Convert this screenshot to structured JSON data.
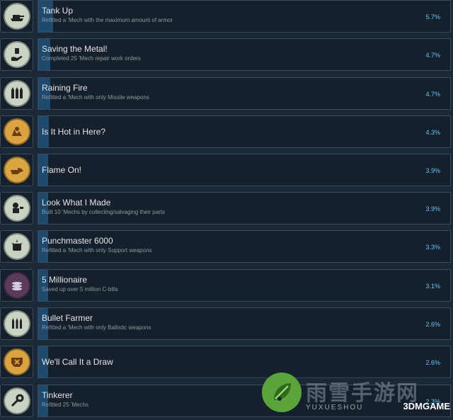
{
  "achievements": [
    {
      "title": "Tank Up",
      "description": "Refitted a 'Mech with the maximum amount of armor",
      "percent": "5.7%",
      "progress": 0.057,
      "icon": "tank-icon",
      "icon_color": "#c9d3c4"
    },
    {
      "title": "Saving the Metal!",
      "description": "Completed 25 'Mech repair work orders",
      "percent": "4.7%",
      "progress": 0.047,
      "icon": "repair-hand-icon",
      "icon_color": "#c9d3c4"
    },
    {
      "title": "Raining Fire",
      "description": "Refitted a 'Mech with only Missile weapons",
      "percent": "4.7%",
      "progress": 0.047,
      "icon": "missiles-icon",
      "icon_color": "#c9d3c4"
    },
    {
      "title": "Is It Hot in Here?",
      "description": "",
      "percent": "4.3%",
      "progress": 0.043,
      "icon": "heat-icon",
      "icon_color": "#d9a441"
    },
    {
      "title": "Flame On!",
      "description": "",
      "percent": "3.9%",
      "progress": 0.039,
      "icon": "flame-fist-icon",
      "icon_color": "#d9a441"
    },
    {
      "title": "Look What I Made",
      "description": "Built 10 'Mechs by collecting/salvaging their parts",
      "percent": "3.9%",
      "progress": 0.039,
      "icon": "mech-build-icon",
      "icon_color": "#c9d3c4"
    },
    {
      "title": "Punchmaster 6000",
      "description": "Refitted a 'Mech with only Support weapons",
      "percent": "3.3%",
      "progress": 0.033,
      "icon": "fist-icon",
      "icon_color": "#c9d3c4"
    },
    {
      "title": "5 Millionaire",
      "description": "Saved up over 5 million C-bills",
      "percent": "3.1%",
      "progress": 0.031,
      "icon": "coins-icon",
      "icon_color": "#5a3b5c"
    },
    {
      "title": "Bullet Farmer",
      "description": "Refitted a 'Mech with only Ballistic weapons",
      "percent": "2.6%",
      "progress": 0.026,
      "icon": "bullets-icon",
      "icon_color": "#c9d3c4"
    },
    {
      "title": "We'll Call It a Draw",
      "description": "",
      "percent": "2.6%",
      "progress": 0.026,
      "icon": "broken-mech-icon",
      "icon_color": "#d9a441"
    },
    {
      "title": "Tinkerer",
      "description": "Refitted 25 'Mechs",
      "percent": "2.3%",
      "progress": 0.023,
      "icon": "wrench-icon",
      "icon_color": "#c9d3c4"
    }
  ],
  "watermark": {
    "chinese": "雨雪手游网",
    "english": "YUXUESHOU",
    "brand": "3DMGAME"
  }
}
